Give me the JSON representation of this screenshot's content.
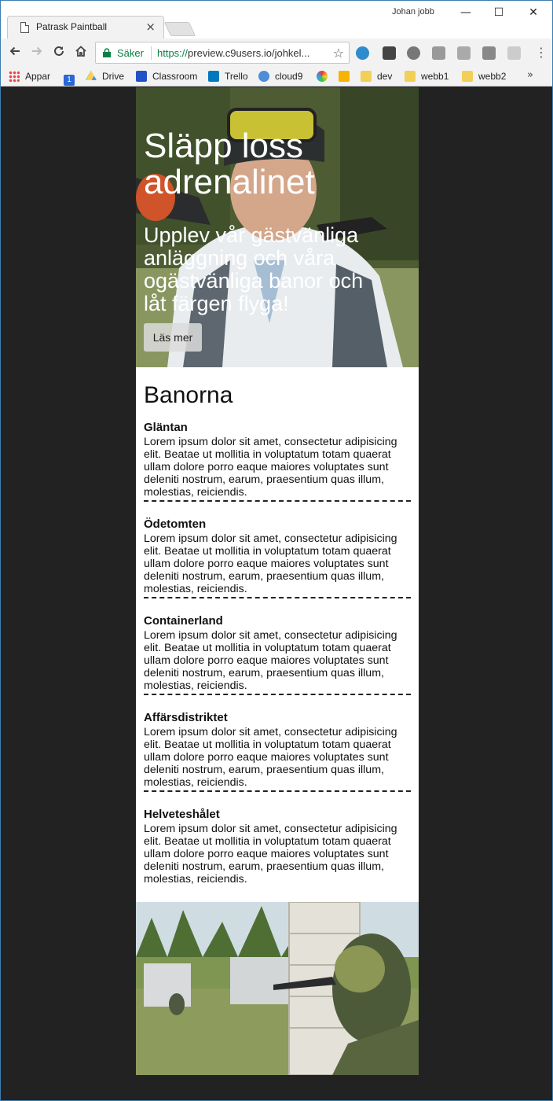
{
  "browser": {
    "tab_title": "Patrask Paintball",
    "tab_close": "×",
    "user_name": "Johan jobb",
    "window_controls": {
      "minimize": "—",
      "maximize": "☐",
      "close": "✕"
    },
    "secure_label": "Säker",
    "url_scheme": "https://",
    "url_rest": "preview.c9users.io/johkel...",
    "bookmarks": [
      "Appar",
      "Drive",
      "Classroom",
      "Trello",
      "cloud9",
      "dev",
      "webb1",
      "webb2"
    ],
    "bookmarks_more": "»",
    "colors": {
      "secure": "#0b8043",
      "frame": "#3c7fb1"
    }
  },
  "hero": {
    "title": "Släpp loss adrenalinet",
    "subtitle": "Upplev vår gästvänliga anläggning och våra ogästvänliga banor och låt färgen flyga!",
    "button": "Läs mer"
  },
  "courses": {
    "heading": "Banorna",
    "items": [
      {
        "name": "Gläntan",
        "text": "Lorem ipsum dolor sit amet, consectetur adipisicing elit. Beatae ut mollitia in voluptatum totam quaerat ullam dolore porro eaque maiores voluptates sunt deleniti nostrum, earum, praesentium quas illum, molestias, reiciendis."
      },
      {
        "name": "Ödetomten",
        "text": "Lorem ipsum dolor sit amet, consectetur adipisicing elit. Beatae ut mollitia in voluptatum totam quaerat ullam dolore porro eaque maiores voluptates sunt deleniti nostrum, earum, praesentium quas illum, molestias, reiciendis."
      },
      {
        "name": "Containerland",
        "text": "Lorem ipsum dolor sit amet, consectetur adipisicing elit. Beatae ut mollitia in voluptatum totam quaerat ullam dolore porro eaque maiores voluptates sunt deleniti nostrum, earum, praesentium quas illum, molestias, reiciendis."
      },
      {
        "name": "Affärsdistriktet",
        "text": "Lorem ipsum dolor sit amet, consectetur adipisicing elit. Beatae ut mollitia in voluptatum totam quaerat ullam dolore porro eaque maiores voluptates sunt deleniti nostrum, earum, praesentium quas illum, molestias, reiciendis."
      },
      {
        "name": "Helveteshålet",
        "text": "Lorem ipsum dolor sit amet, consectetur adipisicing elit. Beatae ut mollitia in voluptatum totam quaerat ullam dolore porro eaque maiores voluptates sunt deleniti nostrum, earum, praesentium quas illum, molestias, reiciendis."
      }
    ]
  },
  "icons": {
    "back": "arrow-left-icon",
    "forward": "arrow-right-icon",
    "reload": "reload-icon",
    "home": "home-icon",
    "lock": "lock-icon",
    "star": "star-icon",
    "menu": "more-vert-icon"
  }
}
